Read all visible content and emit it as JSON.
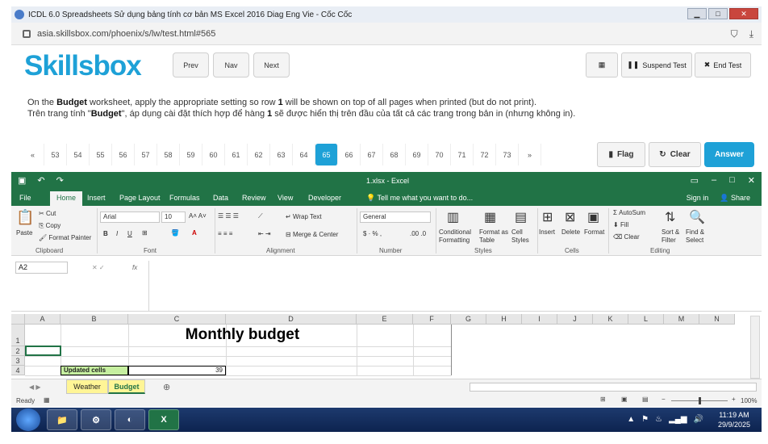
{
  "browser": {
    "title": "ICDL 6.0 Spreadsheets Sử dụng bảng tính cơ bản MS Excel 2016 Diag Eng Vie - Cốc Cốc",
    "url": "asia.skillsbox.com/phoenix/s/lw/test.html#565"
  },
  "header": {
    "logo": "Skillsbox",
    "prev": "Prev",
    "nav": "Nav",
    "next": "Next",
    "suspend": "Suspend Test",
    "end": "End Test"
  },
  "instruction": {
    "en_pre": "On the ",
    "en_sheet": "Budget",
    "en_mid": " worksheet, apply the appropriate setting so row ",
    "en_row": "1",
    "en_post": " will be shown on top of all pages when printed (but do not print).",
    "vi_pre": "Trên trang tính \"",
    "vi_sheet": "Budget",
    "vi_mid": "\", áp dụng cài đặt thích hợp để hàng ",
    "vi_row": "1",
    "vi_post": " sẽ được hiển thị trên đầu của tất cả các trang trong bản in (nhưng không in)."
  },
  "pager": {
    "first": "«",
    "pages": [
      "53",
      "54",
      "55",
      "56",
      "57",
      "58",
      "59",
      "60",
      "61",
      "62",
      "63",
      "64",
      "65",
      "66",
      "67",
      "68",
      "69",
      "70",
      "71",
      "72",
      "73"
    ],
    "active": "65",
    "last": "»",
    "flag": "Flag",
    "clear": "Clear",
    "answer": "Answer"
  },
  "excel": {
    "filename": "1.xlsx - Excel",
    "tabs": [
      "File",
      "Home",
      "Insert",
      "Page Layout",
      "Formulas",
      "Data",
      "Review",
      "View",
      "Developer"
    ],
    "tell_me": "Tell me what you want to do...",
    "sign_in": "Sign in",
    "share": "Share",
    "ribbon": {
      "paste": "Paste",
      "cut": "Cut",
      "copy": "Copy",
      "format_painter": "Format Painter",
      "clipboard": "Clipboard",
      "font_name": "Arial",
      "font_size": "10",
      "font": "Font",
      "wrap_text": "Wrap Text",
      "merge_center": "Merge & Center",
      "alignment": "Alignment",
      "number_format": "General",
      "number": "Number",
      "conditional_formatting": "Conditional Formatting",
      "format_as_table": "Format as Table",
      "cell_styles": "Cell Styles",
      "styles": "Styles",
      "insert": "Insert",
      "delete": "Delete",
      "format": "Format",
      "cells": "Cells",
      "autosum": "AutoSum",
      "fill": "Fill",
      "clear": "Clear",
      "sort_filter": "Sort & Filter",
      "find_select": "Find & Select",
      "editing": "Editing"
    },
    "name_box": "A2",
    "fx": "fx",
    "columns": [
      "A",
      "B",
      "C",
      "D",
      "E",
      "F",
      "G",
      "H",
      "I",
      "J",
      "K",
      "L",
      "M",
      "N"
    ],
    "rows": [
      "1",
      "2",
      "3",
      "4"
    ],
    "cells": {
      "title": "Monthly budget",
      "b4": "Updated cells",
      "c4": "39"
    },
    "sheets": [
      "Weather",
      "Budget"
    ],
    "active_sheet": "Budget",
    "status": "Ready",
    "zoom": "100%"
  },
  "taskbar": {
    "time": "11:19 AM",
    "date": "29/9/2025"
  }
}
